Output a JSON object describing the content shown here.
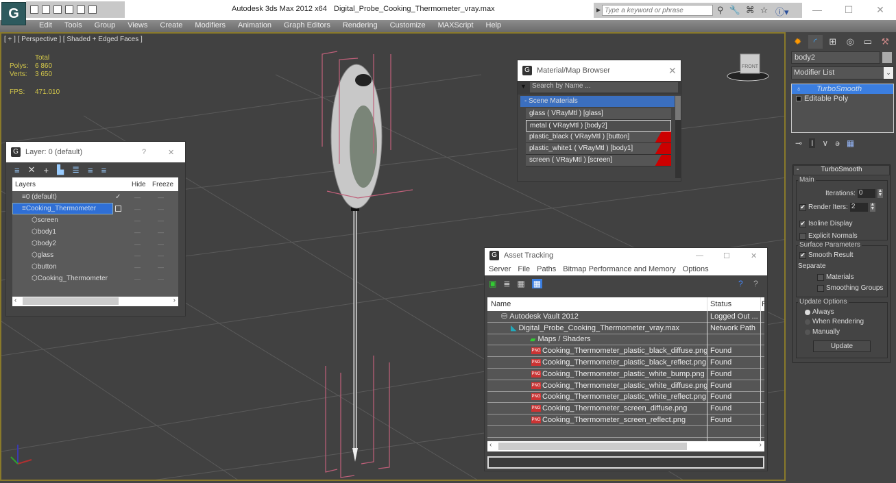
{
  "titlebar": {
    "app_title": "Autodesk 3ds Max  2012 x64",
    "file_name": "Digital_Probe_Cooking_Thermometer_vray.max",
    "search_placeholder": "Type a keyword or phrase",
    "minimize": "—",
    "maximize": "☐",
    "close": "✕"
  },
  "menubar": [
    "Edit",
    "Tools",
    "Group",
    "Views",
    "Create",
    "Modifiers",
    "Animation",
    "Graph Editors",
    "Rendering",
    "Customize",
    "MAXScript",
    "Help"
  ],
  "viewport": {
    "label": "[ + ] [ Perspective ] [ Shaded + Edged Faces ]",
    "stats": {
      "header": "Total",
      "polys_label": "Polys:",
      "polys": "6 860",
      "verts_label": "Verts:",
      "verts": "3 650",
      "fps_label": "FPS:",
      "fps": "471.010"
    },
    "viewcube_label": "FRONT"
  },
  "layer_window": {
    "title": "Layer: 0 (default)",
    "help": "?",
    "close": "✕",
    "columns": [
      "Layers",
      "Hide",
      "Freeze"
    ],
    "rows": [
      {
        "name": "0 (default)",
        "level": 1,
        "current": "✓"
      },
      {
        "name": "Cooking_Thermometer",
        "level": 1,
        "selected": true
      },
      {
        "name": "screen",
        "level": 2
      },
      {
        "name": "body1",
        "level": 2
      },
      {
        "name": "body2",
        "level": 2
      },
      {
        "name": "glass",
        "level": 2
      },
      {
        "name": "button",
        "level": 2
      },
      {
        "name": "Cooking_Thermometer",
        "level": 2
      }
    ],
    "dash": "—"
  },
  "material_browser": {
    "title": "Material/Map Browser",
    "close": "✕",
    "search_placeholder": "Search by Name ...",
    "group": "- Scene Materials",
    "materials": [
      {
        "label": "glass  ( VRayMtl ) [glass]",
        "red": false,
        "selected": false
      },
      {
        "label": "metal  ( VRayMtl ) [body2]",
        "red": false,
        "selected": true
      },
      {
        "label": "plastic_black  ( VRayMtl ) [button]",
        "red": true,
        "selected": false
      },
      {
        "label": "plastic_white1  ( VRayMtl ) [body1]",
        "red": true,
        "selected": false
      },
      {
        "label": "screen  ( VRayMtl ) [screen]",
        "red": true,
        "selected": false
      }
    ]
  },
  "asset_tracking": {
    "title": "Asset Tracking",
    "menu": [
      "Server",
      "File",
      "Paths",
      "Bitmap Performance and Memory",
      "Options"
    ],
    "columns": [
      "Name",
      "Status",
      "F"
    ],
    "rows": [
      {
        "name": "Autodesk Vault 2012",
        "status": "Logged Out ...",
        "level": 1,
        "icon": "vault"
      },
      {
        "name": "Digital_Probe_Cooking_Thermometer_vray.max",
        "status": "Network Path",
        "level": 2,
        "icon": "max"
      },
      {
        "name": "Maps / Shaders",
        "status": "",
        "level": 3,
        "icon": "maps"
      },
      {
        "name": "Cooking_Thermometer_plastic_black_diffuse.png",
        "status": "Found",
        "level": 4,
        "icon": "png"
      },
      {
        "name": "Cooking_Thermometer_plastic_black_reflect.png",
        "status": "Found",
        "level": 4,
        "icon": "png"
      },
      {
        "name": "Cooking_Thermometer_plastic_white_bump.png",
        "status": "Found",
        "level": 4,
        "icon": "png"
      },
      {
        "name": "Cooking_Thermometer_plastic_white_diffuse.png",
        "status": "Found",
        "level": 4,
        "icon": "png"
      },
      {
        "name": "Cooking_Thermometer_plastic_white_reflect.png",
        "status": "Found",
        "level": 4,
        "icon": "png"
      },
      {
        "name": "Cooking_Thermometer_screen_diffuse.png",
        "status": "Found",
        "level": 4,
        "icon": "png"
      },
      {
        "name": "Cooking_Thermometer_screen_reflect.png",
        "status": "Found",
        "level": 4,
        "icon": "png"
      }
    ],
    "png_badge": "PNG"
  },
  "command_panel": {
    "object_name": "body2",
    "modifier_list": "Modifier List",
    "stack": [
      "TurboSmooth",
      "Editable Poly"
    ],
    "rollout": {
      "title": "TurboSmooth",
      "collapse": "-",
      "main_group": "Main",
      "iterations_label": "Iterations:",
      "iterations": "0",
      "render_iters_label": "Render Iters:",
      "render_iters": "2",
      "render_iters_checked": true,
      "isoline_label": "Isoline Display",
      "isoline_checked": true,
      "explicit_normals_label": "Explicit Normals",
      "explicit_normals_checked": false,
      "surface_group": "Surface Parameters",
      "smooth_result_label": "Smooth Result",
      "smooth_result_checked": true,
      "separate_label": "Separate",
      "materials_label": "Materials",
      "smoothing_groups_label": "Smoothing Groups",
      "update_group": "Update Options",
      "update_options": [
        "Always",
        "When Rendering",
        "Manually"
      ],
      "update_selected": "Always",
      "update_button": "Update"
    }
  }
}
